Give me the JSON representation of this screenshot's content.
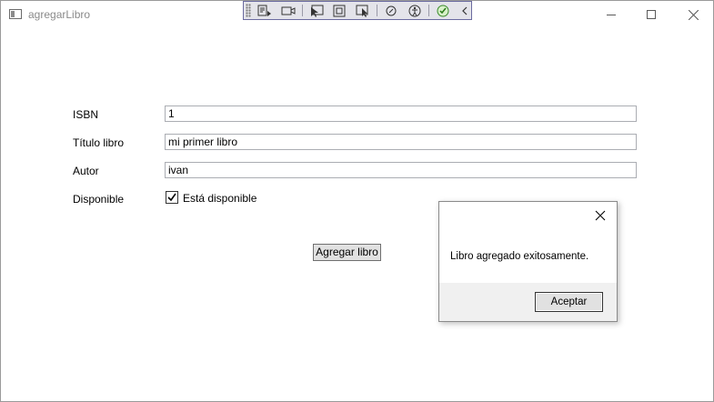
{
  "window": {
    "title": "agregarLibro"
  },
  "form": {
    "isbn_label": "ISBN",
    "isbn_value": "1",
    "titulo_label": "Título libro",
    "titulo_value": "mi primer libro",
    "autor_label": "Autor",
    "autor_value": "ivan",
    "disponible_label": "Disponible",
    "disponible_checkbox_label": "Está disponible",
    "disponible_checked": true,
    "submit_label": "Agregar libro"
  },
  "dialog": {
    "message": "Libro agregado exitosamente.",
    "ok_label": "Aceptar"
  },
  "icons": {
    "app": "window-icon",
    "minimize": "minimize-icon",
    "maximize": "maximize-icon",
    "close": "close-icon"
  }
}
